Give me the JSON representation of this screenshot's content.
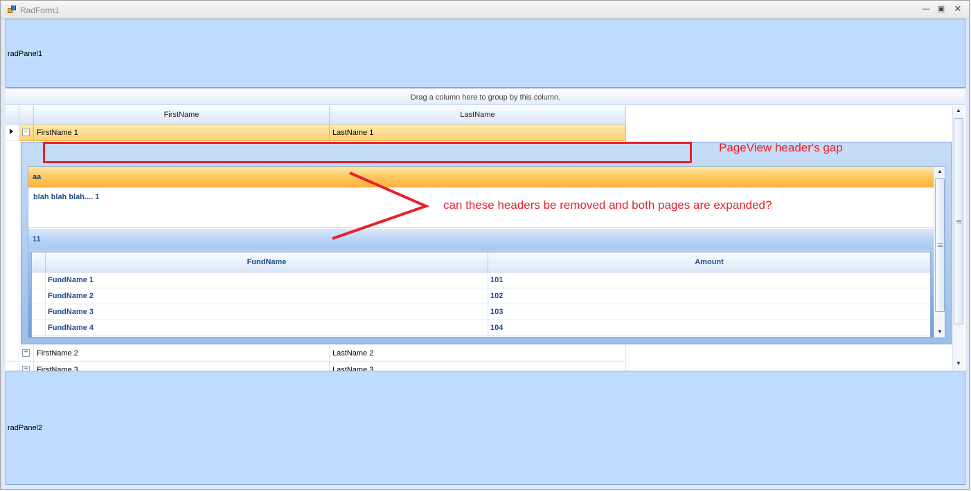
{
  "window": {
    "title": "RadForm1"
  },
  "panels": {
    "top_label": "radPanel1",
    "bottom_label": "radPanel2"
  },
  "grid": {
    "group_panel_text": "Drag a column here to group by this column.",
    "columns": [
      "FirstName",
      "LastName"
    ],
    "rows": [
      {
        "first": "FirstName 1",
        "last": "LastName 1",
        "expanded": true,
        "selected": true
      },
      {
        "first": "FirstName 2",
        "last": "LastName 2",
        "expanded": false,
        "selected": false
      },
      {
        "first": "FirstName 3",
        "last": "LastName 3",
        "expanded": false,
        "selected": false
      }
    ]
  },
  "pageview": {
    "page1": {
      "header": "aa",
      "content": "blah blah blah....   1"
    },
    "page2": {
      "header": "11"
    },
    "inner_grid": {
      "columns": [
        "FundName",
        "Amount"
      ],
      "rows": [
        {
          "fund": "FundName 1",
          "amount": "101"
        },
        {
          "fund": "FundName 2",
          "amount": "102"
        },
        {
          "fund": "FundName 3",
          "amount": "103"
        },
        {
          "fund": "FundName 4",
          "amount": "104"
        }
      ]
    }
  },
  "annotations": {
    "gap_label": "PageView header's gap",
    "question": "can these headers be removed and both pages are expanded?",
    "color": "#e8202c"
  },
  "icons": [
    "app-icon",
    "minimize-icon",
    "maximize-icon",
    "close-icon",
    "current-row-arrow-icon",
    "collapse-icon",
    "expand-icon",
    "scroll-up-icon",
    "scroll-down-icon"
  ]
}
